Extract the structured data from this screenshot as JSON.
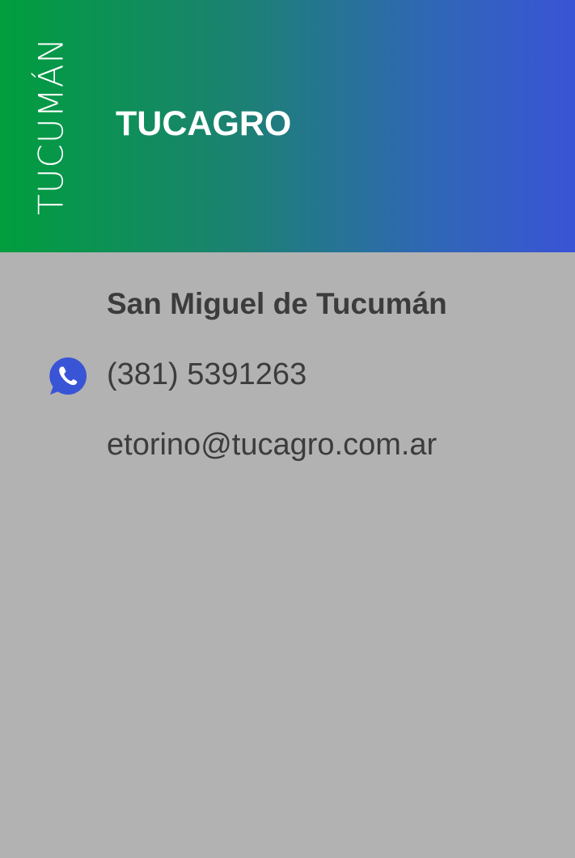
{
  "header": {
    "province": "TUCUMÁN",
    "company": "TUCAGRO",
    "gradient_colors": [
      "#009e3d",
      "#1b8270",
      "#2f67b5",
      "#3a54d6"
    ]
  },
  "contact": {
    "city": "San Miguel de Tucumán",
    "phone_icon": "whatsapp-icon",
    "phone": "(381) 5391263",
    "email": "etorino@tucagro.com.ar"
  },
  "colors": {
    "body_background": "#b2b2b2",
    "text": "#3c3c3c",
    "icon": "#3a54d6"
  }
}
